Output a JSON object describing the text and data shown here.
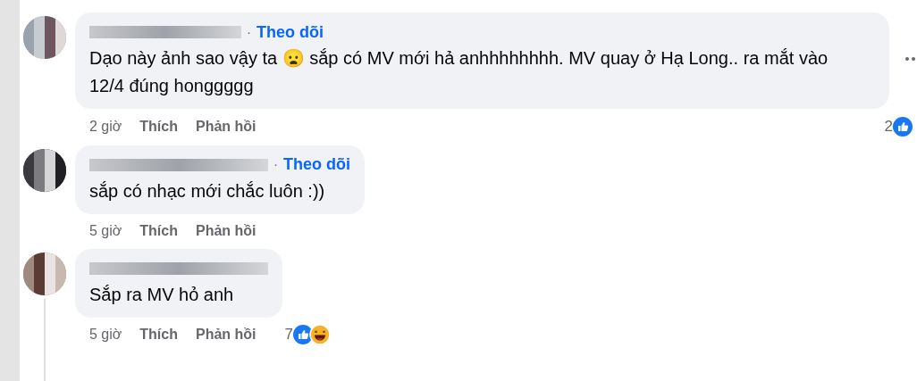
{
  "comments": [
    {
      "separator": "·",
      "follow": "Theo dõi",
      "text": "Dạo này ảnh sao vậy ta 😦 sắp có MV mới hả anhhhhhhhh. MV quay ở Hạ Long.. ra mắt vào 12/4 đúng honggggg",
      "time": "2 giờ",
      "like": "Thích",
      "reply": "Phản hồi",
      "reaction_count": "2",
      "reactions": [
        {
          "kind": "like"
        }
      ],
      "count_beside_bubble": true,
      "thread_line": false,
      "menu": true
    },
    {
      "separator": "·",
      "follow": "Theo dõi",
      "text": "sắp có nhạc mới chắc luôn :))",
      "time": "5 giờ",
      "like": "Thích",
      "reply": "Phản hồi",
      "thread_line": false,
      "menu": false
    },
    {
      "text": "Sắp ra MV hỏ anh",
      "time": "5 giờ",
      "like": "Thích",
      "reply": "Phản hồi",
      "reaction_count": "7",
      "reactions": [
        {
          "kind": "like"
        },
        {
          "kind": "haha"
        }
      ],
      "count_beside_bubble": false,
      "thread_line": true,
      "menu": false
    }
  ]
}
